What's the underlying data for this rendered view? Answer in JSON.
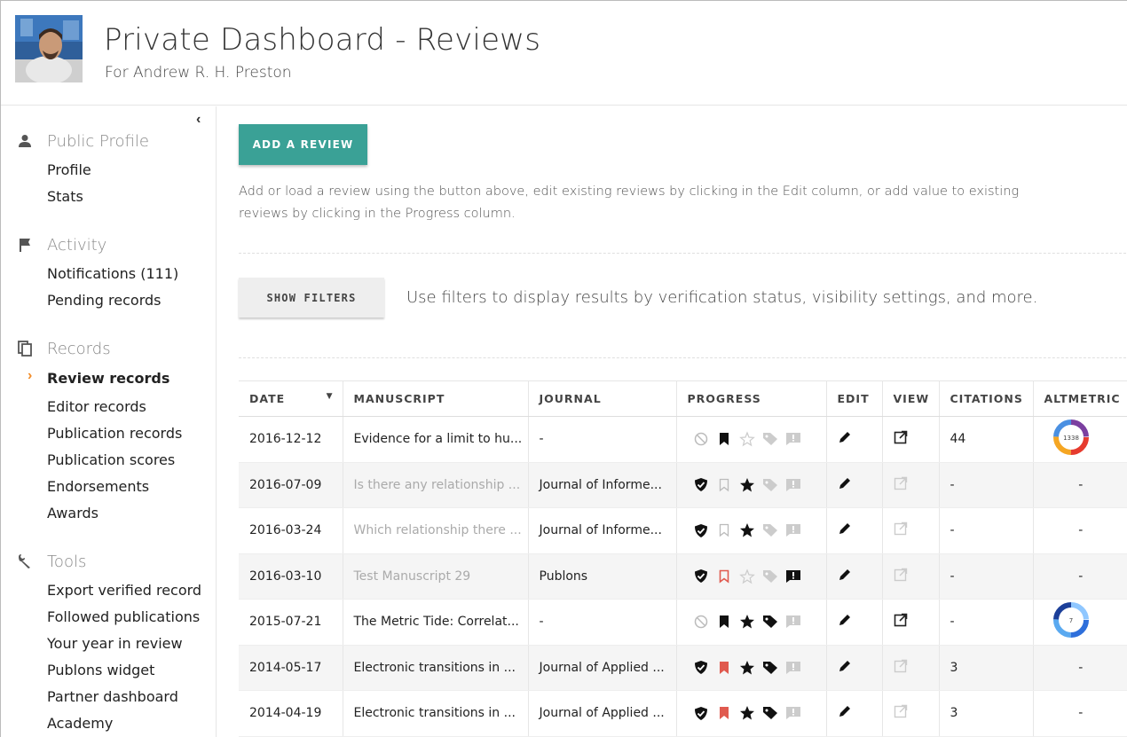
{
  "header": {
    "title": "Private Dashboard - Reviews",
    "subtitle": "For Andrew R. H. Preston"
  },
  "sidebar": {
    "collapse_glyph": "‹",
    "sections": [
      {
        "label": "Public Profile",
        "icon": "person-icon",
        "items": [
          "Profile",
          "Stats"
        ]
      },
      {
        "label": "Activity",
        "icon": "flag-icon",
        "items": [
          "Notifications (111)",
          "Pending records"
        ]
      },
      {
        "label": "Records",
        "icon": "copy-icon",
        "items": [
          "Review records",
          "Editor records",
          "Publication records",
          "Publication scores",
          "Endorsements",
          "Awards"
        ]
      },
      {
        "label": "Tools",
        "icon": "wrench-icon",
        "items": [
          "Export verified record",
          "Followed publications",
          "Your year in review",
          "Publons widget",
          "Partner dashboard",
          "Academy"
        ]
      }
    ],
    "active_item": "Review records",
    "active_glyph": "›"
  },
  "main": {
    "add_review_label": "ADD A REVIEW",
    "help_text": "Add or load a review using the button above, edit existing reviews by clicking in the Edit column, or add value to existing reviews by clicking in the Progress column.",
    "show_filters_label": "SHOW FILTERS",
    "filters_text": "Use filters to display results by verification status, visibility settings, and more."
  },
  "table": {
    "columns": [
      "DATE",
      "MANUSCRIPT",
      "JOURNAL",
      "PROGRESS",
      "EDIT",
      "VIEW",
      "CITATIONS",
      "ALTMETRIC"
    ],
    "sort_glyph": "▼",
    "rows": [
      {
        "date": "2016-12-12",
        "manuscript": "Evidence for a limit to hu...",
        "journal": "-",
        "citations": "44",
        "altmetric": "badge",
        "altmetric_score": "1338",
        "manuscript_muted": false,
        "view_active": true
      },
      {
        "date": "2016-07-09",
        "manuscript": "Is there any relationship ...",
        "journal": "Journal of Informe...",
        "citations": "-",
        "altmetric": "-",
        "manuscript_muted": true,
        "view_active": false
      },
      {
        "date": "2016-03-24",
        "manuscript": "Which relationship there ...",
        "journal": "Journal of Informe...",
        "citations": "-",
        "altmetric": "-",
        "manuscript_muted": true,
        "view_active": false
      },
      {
        "date": "2016-03-10",
        "manuscript": "Test Manuscript 29",
        "journal": "Publons",
        "citations": "-",
        "altmetric": "-",
        "manuscript_muted": true,
        "view_active": false
      },
      {
        "date": "2015-07-21",
        "manuscript": "The Metric Tide: Correlat...",
        "journal": "-",
        "citations": "-",
        "altmetric": "badge",
        "altmetric_score": "7",
        "manuscript_muted": false,
        "view_active": true
      },
      {
        "date": "2014-05-17",
        "manuscript": "Electronic transitions in ...",
        "journal": "Journal of Applied ...",
        "citations": "3",
        "altmetric": "-",
        "manuscript_muted": false,
        "view_active": false
      },
      {
        "date": "2014-04-19",
        "manuscript": "Electronic transitions in ...",
        "journal": "Journal of Applied ...",
        "citations": "3",
        "altmetric": "-",
        "manuscript_muted": false,
        "view_active": false
      }
    ]
  },
  "colors": {
    "accent": "#3aa196",
    "active_chevron": "#f28c28",
    "bookmark_red": "#e05a4f"
  }
}
